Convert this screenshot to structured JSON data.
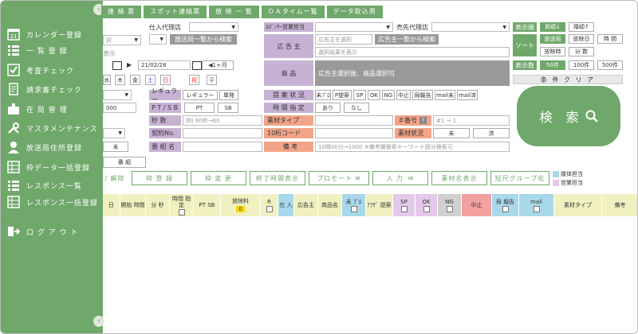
{
  "top_tabs": [
    "連 絡 票",
    "スポット連絡票",
    "放 映 一 覧",
    "ＯＡタイム一覧",
    "データ取込用"
  ],
  "sidebar": {
    "items": [
      {
        "label": "カレンダー登録",
        "icon": "calendar-icon"
      },
      {
        "label": "一 覧 登 録",
        "icon": "list-icon"
      },
      {
        "label": "考査チェック",
        "icon": "check-icon"
      },
      {
        "label": "請求書チェック",
        "icon": "invoice-icon"
      },
      {
        "label": "在 局 管 理",
        "icon": "station-icon"
      },
      {
        "label": "マスタメンテナンス",
        "icon": "tools-icon"
      },
      {
        "label": "放送局住所登録",
        "icon": "person-icon"
      },
      {
        "label": "枠データ一括登録",
        "icon": "grid-icon"
      },
      {
        "label": "レスポンス一覧",
        "icon": "list-icon"
      },
      {
        "label": "レスポンス一括登録",
        "icon": "grid-icon"
      }
    ],
    "logout": "ロ グ ア ウ ト"
  },
  "form": {
    "agency_label": "仕入代理店",
    "station_btn": "放送局一覧から検索",
    "sponsor_label": "ｽﾎﾟﾝｻｰ営業担当",
    "reseller_label": "売先代理店",
    "left_select_placeholder": "択",
    "left_text_fragment": "表示",
    "advertiser_label": "広 告 主",
    "advertiser_placeholder": "広告主を選択",
    "advertiser_btn": "広告主一覧から検索",
    "selection_result": "選択結果を表示",
    "date_to": "21/02/28",
    "period": "1ヶ月",
    "product_label": "商 品",
    "product_note": "広告主選択後、商品選択可",
    "weekdays": [
      "水",
      "木",
      "金",
      "土",
      "日",
      "祝",
      "平"
    ],
    "regular_label": "レギュラー",
    "regular_select": "レギュラー",
    "single_btn": "単発",
    "ptsb_label": "P T / S B",
    "pt_btn": "PT",
    "sb_btn": "SB",
    "seconds_label": "秒 数",
    "seconds_placeholder": "例) 60秒→60",
    "contract_label": "契約No.",
    "program_label": "番 組 名",
    "left_num": "000",
    "left_unset": "未",
    "proposal_label": "提 案 状 況",
    "proposal_opts": [
      "未ﾌﾟﾛ",
      "P提案",
      "SP",
      "OK",
      "NG",
      "中止",
      "局報告",
      "mail未",
      "mail済"
    ],
    "time_label": "時 間 指 定",
    "time_opts": [
      "あり",
      "なし"
    ],
    "material_type_label": "素材タイプ",
    "number_label": "＃番号",
    "number_placeholder": "#1 → 1",
    "code_label": "10桁コード",
    "material_status_label": "素材状況",
    "material_status_opts": [
      "未",
      "済"
    ],
    "note_label": "備 考",
    "note_placeholder": "10時00分→1000 ※備考欄検索キーワード部分検索可",
    "side_labels": {
      "display_order": "表示順",
      "sort": "ソート",
      "count": "表示数"
    },
    "order_opts": [
      "昇順↓",
      "降順↑"
    ],
    "sort_opts": [
      "放送局",
      "放映日",
      "時 間",
      "放映時",
      "分 数"
    ],
    "count_opts": [
      "50件",
      "100件",
      "500件"
    ],
    "clear_btn": "条 件 ク リ ア",
    "search_btn": "検 索",
    "program_tab": "番 組"
  },
  "actions": {
    "select_release": "/ 解除",
    "buttons": [
      "枠 登 録",
      "枠 変 更",
      "終了時間表示",
      "プロモート",
      "入 力",
      "素材名表示",
      "短尺グループ化"
    ],
    "legend": [
      "媒体担当",
      "営業担当"
    ]
  },
  "table_headers": [
    {
      "label": "日"
    },
    {
      "label": "開始 時間"
    },
    {
      "label": "分 秒"
    },
    {
      "label": "時間 指定"
    },
    {
      "label": "PT SB"
    },
    {
      "label": "放映料",
      "badge": "0"
    },
    {
      "label": "R"
    },
    {
      "label": "仕 入"
    },
    {
      "label": "広告主"
    },
    {
      "label": "商品名"
    },
    {
      "label": "未 ﾌﾟﾛ"
    },
    {
      "label": "ｱﾗｻﾞ 提案"
    },
    {
      "label": "SP"
    },
    {
      "label": "OK"
    },
    {
      "label": "NG"
    },
    {
      "label": "中止"
    },
    {
      "label": "局 報告"
    },
    {
      "label": "mail"
    },
    {
      "label": "素材タイプ"
    },
    {
      "label": "備考"
    }
  ],
  "colors": {
    "accent": "#6fa86a",
    "purple": "#c7b2d4",
    "orange": "#f2a488",
    "gray": "#9a9a9a"
  }
}
